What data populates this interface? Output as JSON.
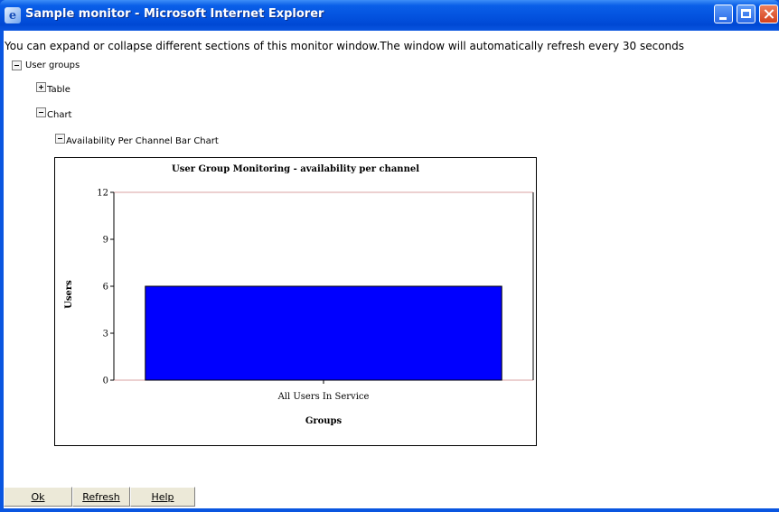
{
  "window": {
    "title": "Sample monitor - Microsoft Internet Explorer",
    "icon": "ie-icon",
    "controls": [
      "minimize-icon",
      "maximize-icon",
      "close-icon"
    ]
  },
  "intro_text": "You can expand or collapse different sections of this monitor window.The window will automatically refresh every 30 seconds",
  "tree": {
    "user_groups": {
      "label": "User groups",
      "state": "expanded"
    },
    "table": {
      "label": "Table",
      "state": "collapsed"
    },
    "chart": {
      "label": "Chart",
      "state": "expanded"
    },
    "bar_chart": {
      "label": "Availability Per Channel Bar Chart",
      "state": "expanded"
    }
  },
  "chart_data": {
    "type": "bar",
    "title": "User Group Monitoring - availability per channel",
    "xlabel": "Groups",
    "ylabel": "Users",
    "categories": [
      "All Users In Service"
    ],
    "values": [
      6
    ],
    "ylim": [
      0,
      12
    ],
    "yticks": [
      0,
      3,
      6,
      9,
      12
    ],
    "bar_color": "#0000ff",
    "grid": false
  },
  "buttons": {
    "ok": "Ok",
    "refresh": "Refresh",
    "help": "Help"
  },
  "colors": {
    "titlebar": "#0a56e0",
    "bar": "#0000ff",
    "axis_line": "#d9a0a0"
  }
}
